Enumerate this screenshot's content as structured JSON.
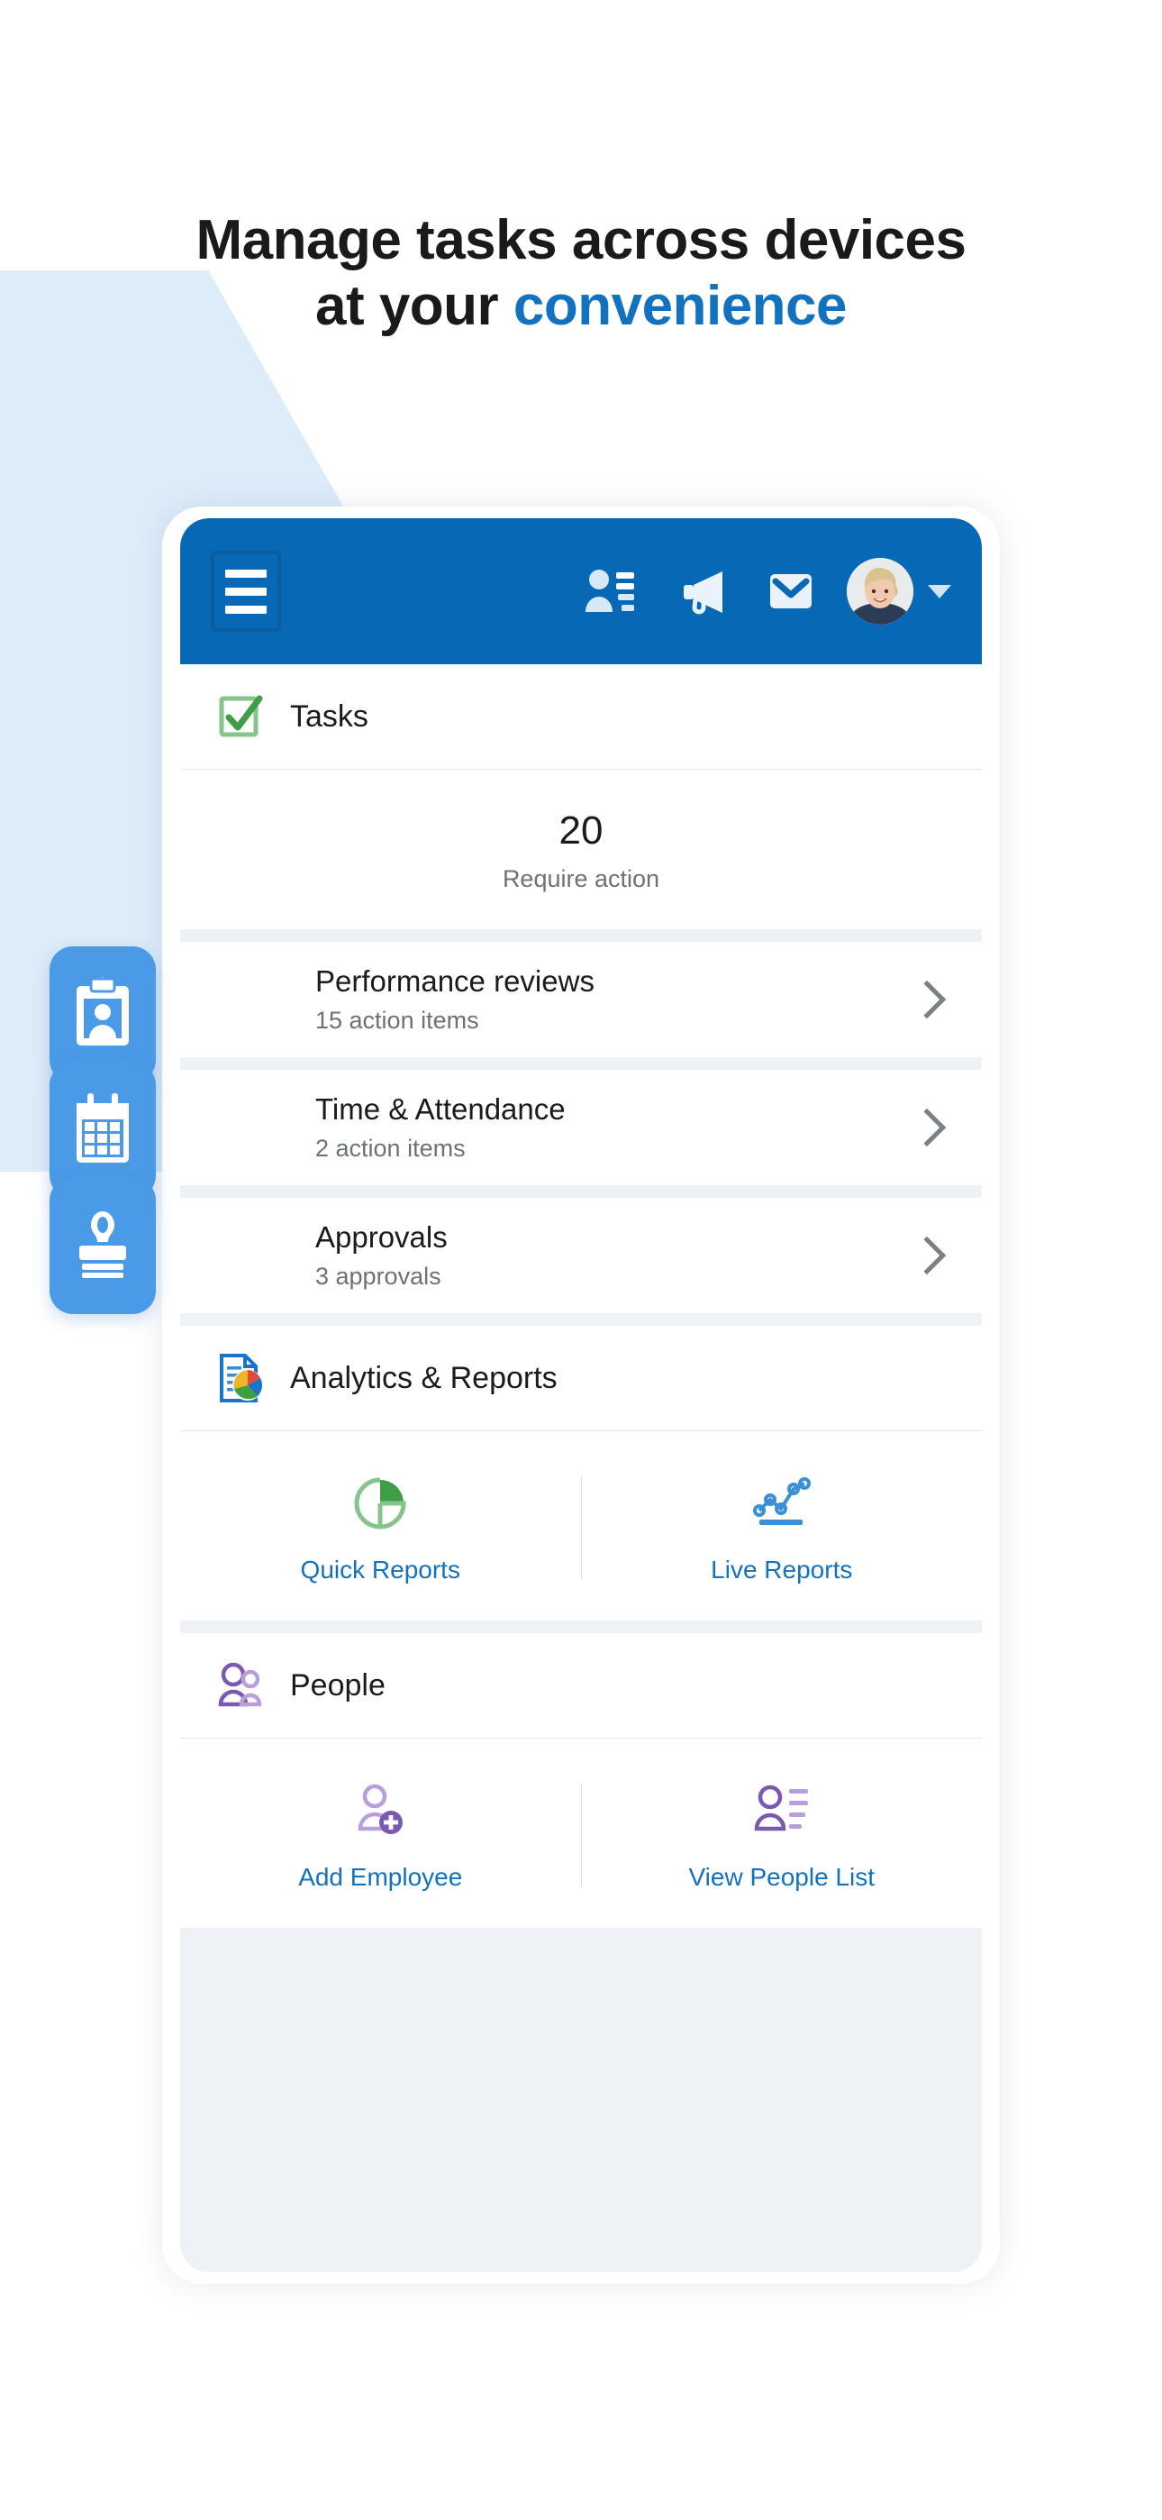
{
  "headline": {
    "line1": "Manage tasks across devices",
    "line2_plain": "at your ",
    "line2_accent": "convenience"
  },
  "colors": {
    "header_blue": "#0769b5",
    "accent_blue": "#1272c0",
    "tile_blue": "#4a9ae8",
    "tasks_green": "#58a55c",
    "people_purple": "#7b59b0",
    "screen_bg": "#eef2f6",
    "polygon_blue": "#ddecf9"
  },
  "appbar": {
    "menu_label": "Menu",
    "icons": [
      {
        "name": "directory-icon",
        "label": "Directory"
      },
      {
        "name": "announcements-icon",
        "label": "Announcements"
      },
      {
        "name": "mail-icon",
        "label": "Mail"
      }
    ],
    "avatar_label": "User profile",
    "caret_label": "Open profile menu"
  },
  "tasks_card": {
    "title": "Tasks",
    "icon": "checkbox-checked-icon",
    "count": "20",
    "count_caption": "Require action"
  },
  "action_rows": [
    {
      "title": "Performance reviews",
      "subtitle": "15 action items",
      "icon": "clipboard-person-icon",
      "chevron": "chevron-right-icon"
    },
    {
      "title": "Time & Attendance",
      "subtitle": "2 action items",
      "icon": "calendar-icon",
      "chevron": "chevron-right-icon"
    },
    {
      "title": "Approvals",
      "subtitle": "3 approvals",
      "icon": "stamp-icon",
      "chevron": "chevron-right-icon"
    }
  ],
  "analytics_card": {
    "title": "Analytics & Reports",
    "icon": "report-document-pie-icon",
    "actions": [
      {
        "label": "Quick Reports",
        "icon": "pie-chart-icon"
      },
      {
        "label": "Live Reports",
        "icon": "line-chart-icon"
      }
    ]
  },
  "people_card": {
    "title": "People",
    "icon": "people-group-icon",
    "actions": [
      {
        "label": "Add Employee",
        "icon": "person-add-icon"
      },
      {
        "label": "View People List",
        "icon": "person-list-icon"
      }
    ]
  }
}
